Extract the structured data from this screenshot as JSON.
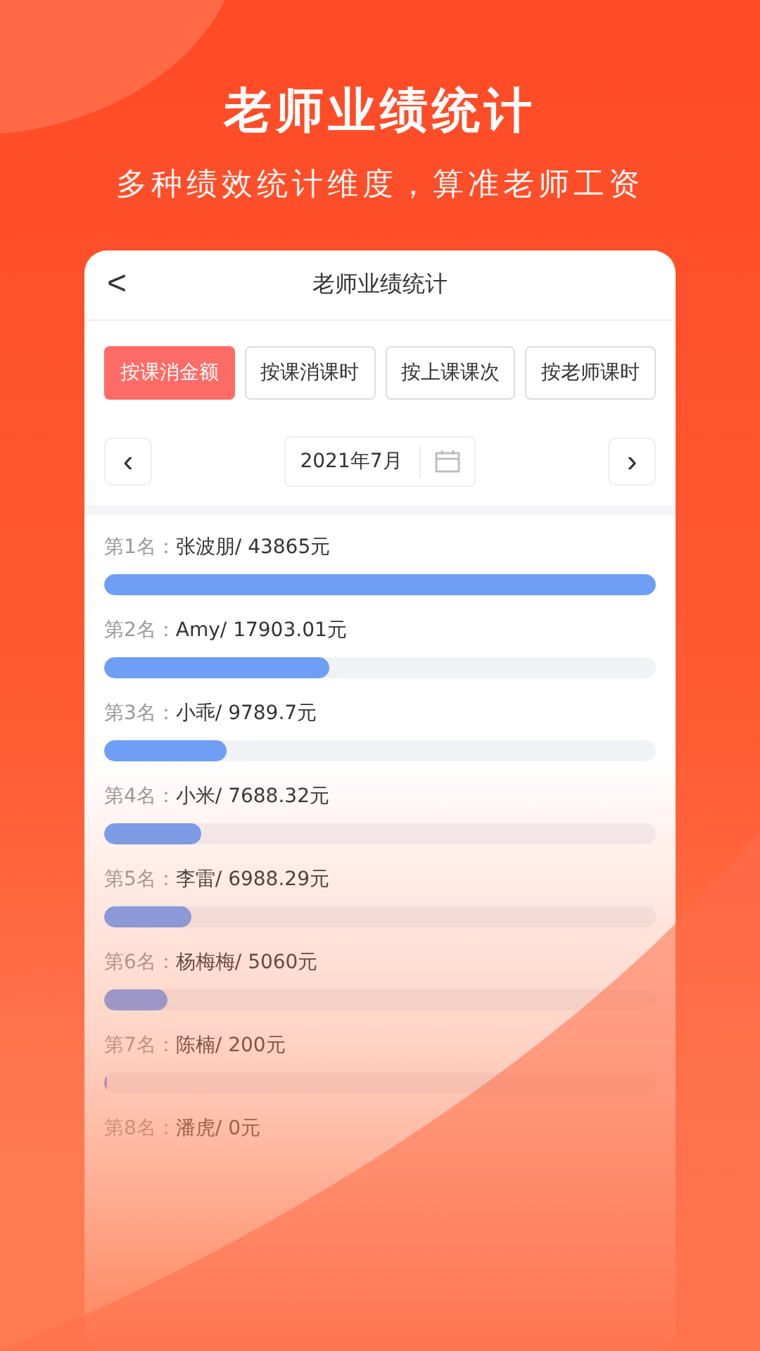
{
  "headline": "老师业绩统计",
  "subtitle": "多种绩效统计维度，算准老师工资",
  "card": {
    "title": "老师业绩统计",
    "back": "<"
  },
  "tabs": [
    {
      "label": "按课消金额",
      "selected": true
    },
    {
      "label": "按课消课时",
      "selected": false
    },
    {
      "label": "按上课课次",
      "selected": false
    },
    {
      "label": "按老师课时",
      "selected": false
    }
  ],
  "period": {
    "prev": "‹",
    "value": "2021年7月",
    "next": "›"
  },
  "ranking": [
    {
      "rank": "第1名：",
      "name": "张波朋/ 43865元",
      "level": 1
    },
    {
      "rank": "第2名：",
      "name": "Amy/ 17903.01元",
      "level": 0.408
    },
    {
      "rank": "第3名：",
      "name": "小乖/ 9789.7元",
      "level": 0.223
    },
    {
      "rank": "第4名：",
      "name": "小米/ 7688.32元",
      "level": 0.175
    },
    {
      "rank": "第5名：",
      "name": "李雷/ 6988.29元",
      "level": 0.159
    },
    {
      "rank": "第6名：",
      "name": "杨梅梅/ 5060元",
      "level": 0.115
    },
    {
      "rank": "第7名：",
      "name": "陈楠/ 200元",
      "level": 0.004
    },
    {
      "rank": "第8名：",
      "name": "潘虎/ 0元"
    }
  ]
}
